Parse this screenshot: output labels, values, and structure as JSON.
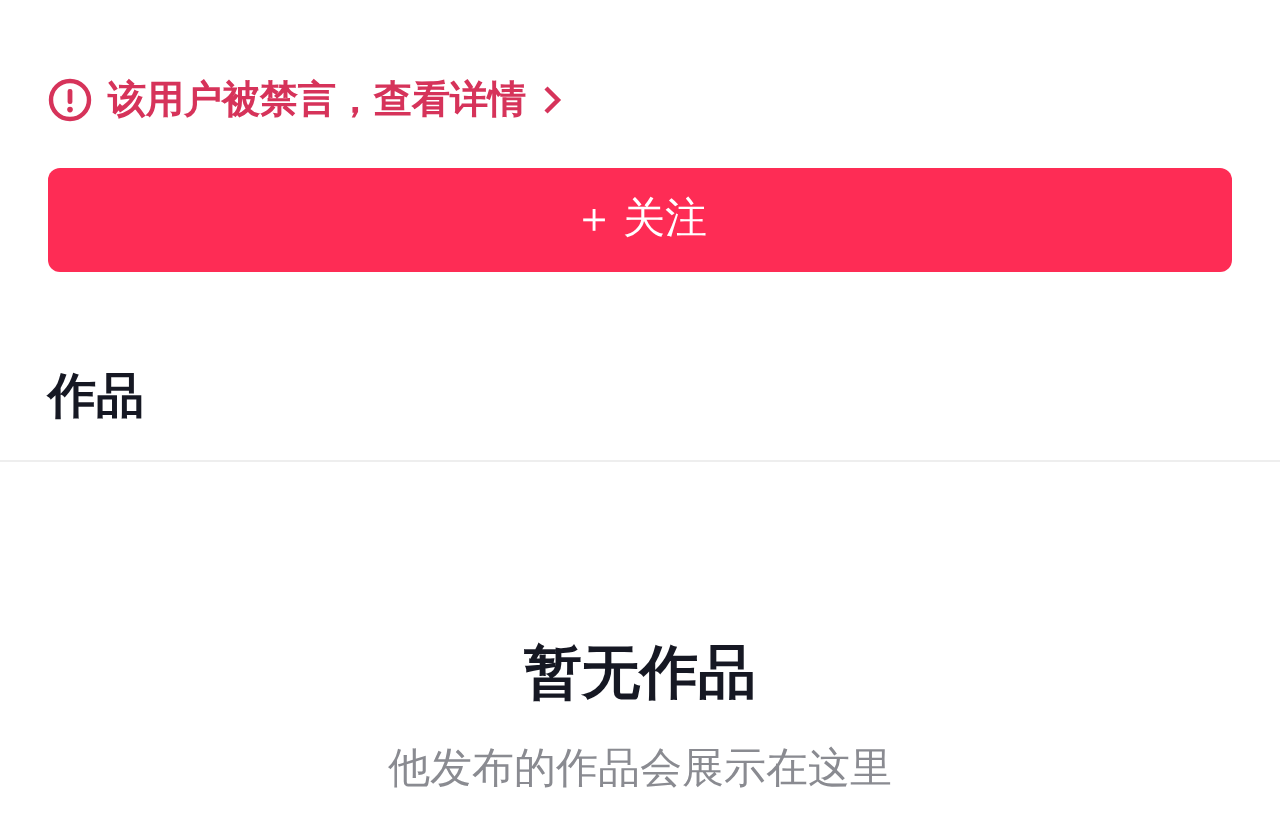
{
  "notice": {
    "text": "该用户被禁言，查看详情"
  },
  "follow_button": {
    "icon": "＋",
    "label": "关注"
  },
  "section": {
    "title": "作品"
  },
  "empty_state": {
    "title": "暂无作品",
    "subtitle": "他发布的作品会展示在这里"
  }
}
